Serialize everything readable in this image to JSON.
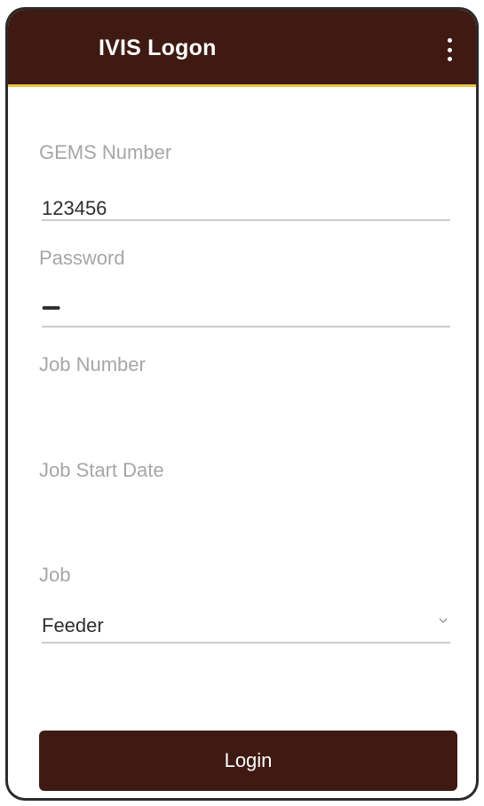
{
  "appbar": {
    "title": "IVIS Logon",
    "menu_icon": "more-vert-icon"
  },
  "form": {
    "gems_number": {
      "label": "GEMS Number",
      "value": "123456"
    },
    "password": {
      "label": "Password",
      "value": "•••••••"
    },
    "job_number": {
      "label": "Job Number",
      "value": ""
    },
    "job_start_date": {
      "label": "Job Start Date",
      "value": ""
    },
    "job": {
      "label": "Job",
      "selected": "Feeder",
      "icon": "chevron-down-icon"
    }
  },
  "login_button": {
    "label": "Login"
  },
  "colors": {
    "appbar": "#3e1a12",
    "accent": "#f0c341",
    "button": "#3e1a12"
  }
}
